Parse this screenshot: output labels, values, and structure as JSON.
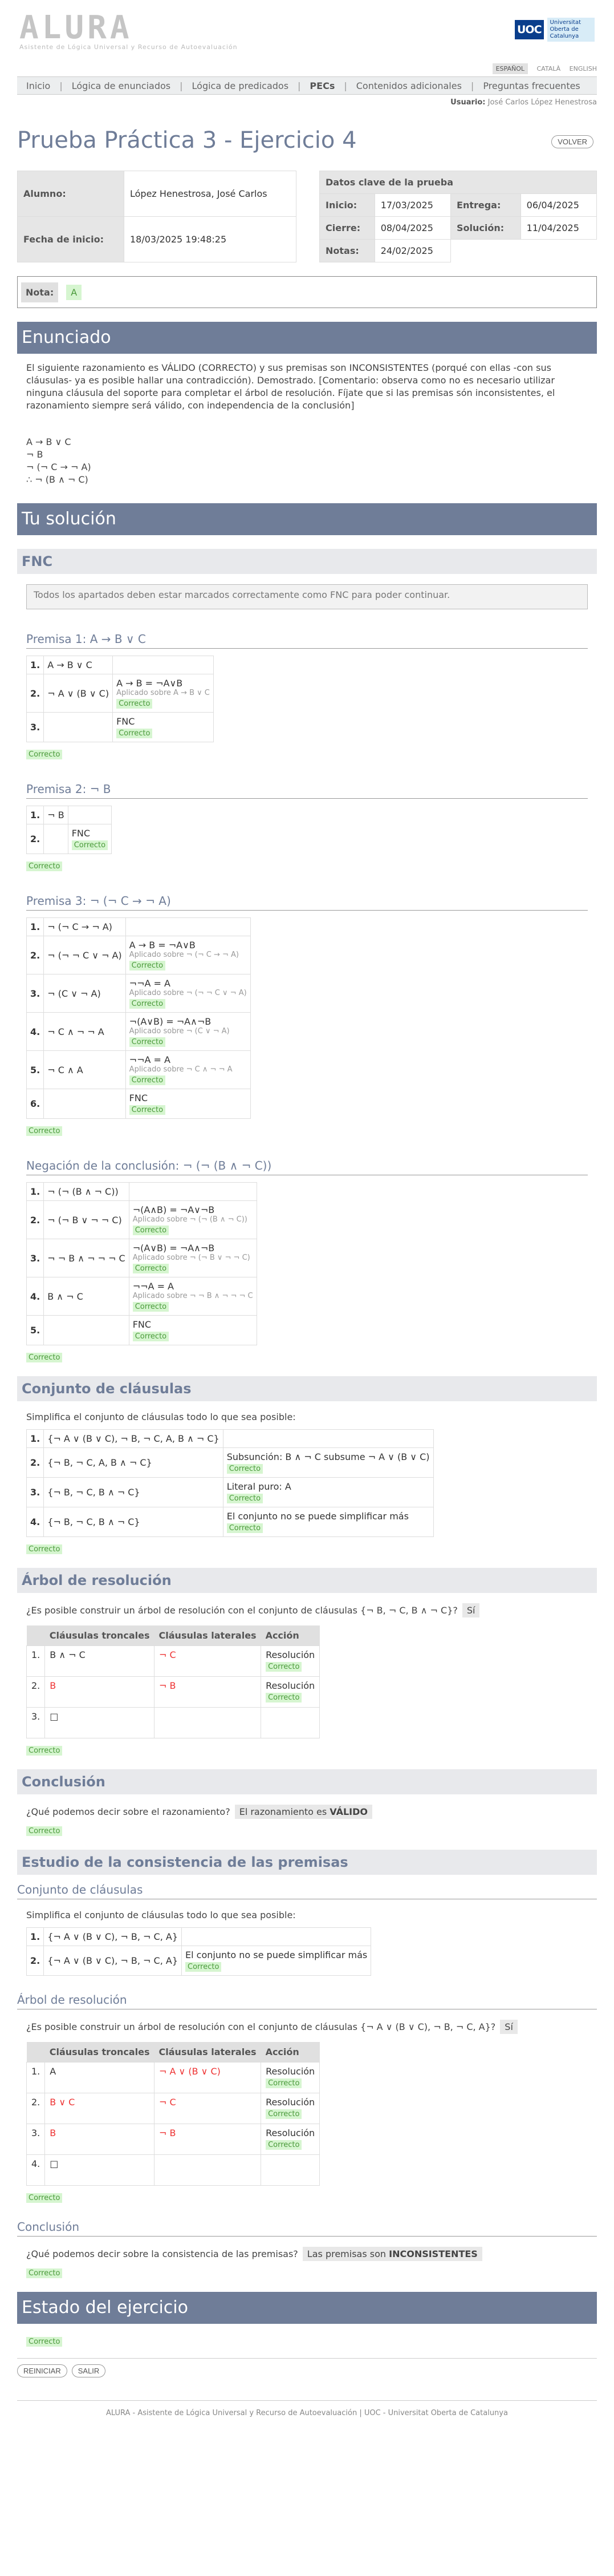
{
  "brand": {
    "logo": "ALURA",
    "tagline": "Asistente de Lógica Universal y Recurso de Autoevaluación",
    "uoc_mark": "UOC",
    "uoc_name": "Universitat Oberta de Catalunya"
  },
  "langs": [
    "Español",
    "Català",
    "English"
  ],
  "menu": [
    "Inicio",
    "Lógica de enunciados",
    "Lógica de predicados",
    "PECs",
    "Contenidos adicionales",
    "Preguntas frecuentes"
  ],
  "user": {
    "label": "Usuario:",
    "value": "José Carlos López Henestrosa"
  },
  "title": "Prueba Práctica 3 - Ejercicio 4",
  "back_btn": "Volver",
  "student": {
    "alumno_label": "Alumno:",
    "alumno": "López Henestrosa, José Carlos",
    "inicio_label": "Fecha de inicio:",
    "inicio": "18/03/2025 19:48:25"
  },
  "keydata": {
    "header": "Datos clave de la prueba",
    "inicio_label": "Inicio:",
    "inicio": "17/03/2025",
    "entrega_label": "Entrega:",
    "entrega": "06/04/2025",
    "cierre_label": "Cierre:",
    "cierre": "08/04/2025",
    "solucion_label": "Solución:",
    "solucion": "11/04/2025",
    "notas_label": "Notas:",
    "notas": "24/02/2025"
  },
  "nota": {
    "label": "Nota:",
    "value": "A"
  },
  "enunciado": {
    "head": "Enunciado",
    "text": "El siguiente razonamiento es VÁLIDO (CORRECTO) y sus premisas son INCONSISTENTES (porqué con ellas -con sus cláusulas- ya es posible hallar una contradicción). Demostrado. [Comentario: observa como no es necesario utilizar ninguna cláusula del soporte para completar el árbol de resolución. Fíjate que si las premisas són inconsistentes, el razonamiento siempre será válido, con independencia de la conclusión]",
    "premises": [
      "A → B ∨ C",
      "¬ B",
      "¬ (¬ C → ¬ A)",
      "∴ ¬ (B ∧ ¬ C)"
    ]
  },
  "solucion": {
    "head": "Tu solución"
  },
  "fnc": {
    "head": "FNC",
    "notice": "Todos los apartados deben estar marcados correctamente como FNC para poder continuar.",
    "correct": "Correcto",
    "p1": {
      "title": "Premisa 1: A → B ∨ C",
      "steps": [
        {
          "n": "1.",
          "f": "A → B ∨ C",
          "r": "",
          "a": ""
        },
        {
          "n": "2.",
          "f": "¬ A ∨ (B ∨ C)",
          "r": "A → B = ¬A∨B",
          "a": "Aplicado sobre A → B ∨ C"
        },
        {
          "n": "3.",
          "f": "",
          "r": "FNC",
          "a": ""
        }
      ]
    },
    "p2": {
      "title": "Premisa 2: ¬ B",
      "steps": [
        {
          "n": "1.",
          "f": "¬ B",
          "r": "",
          "a": ""
        },
        {
          "n": "2.",
          "f": "",
          "r": "FNC",
          "a": ""
        }
      ]
    },
    "p3": {
      "title": "Premisa 3: ¬ (¬ C → ¬ A)",
      "steps": [
        {
          "n": "1.",
          "f": "¬ (¬ C → ¬ A)",
          "r": "",
          "a": ""
        },
        {
          "n": "2.",
          "f": "¬ (¬ ¬ C ∨ ¬ A)",
          "r": "A → B = ¬A∨B",
          "a": "Aplicado sobre ¬ (¬ C → ¬ A)"
        },
        {
          "n": "3.",
          "f": "¬ (C ∨ ¬ A)",
          "r": "¬¬A = A",
          "a": "Aplicado sobre ¬ (¬ ¬ C ∨ ¬ A)"
        },
        {
          "n": "4.",
          "f": "¬ C ∧ ¬ ¬ A",
          "r": "¬(A∨B) = ¬A∧¬B",
          "a": "Aplicado sobre ¬ (C ∨ ¬ A)"
        },
        {
          "n": "5.",
          "f": "¬ C ∧ A",
          "r": "¬¬A = A",
          "a": "Aplicado sobre ¬ C ∧ ¬ ¬ A"
        },
        {
          "n": "6.",
          "f": "",
          "r": "FNC",
          "a": ""
        }
      ]
    },
    "neg": {
      "title": "Negación de la conclusión: ¬ (¬ (B ∧ ¬ C))",
      "steps": [
        {
          "n": "1.",
          "f": "¬ (¬ (B ∧ ¬ C))",
          "r": "",
          "a": ""
        },
        {
          "n": "2.",
          "f": "¬ (¬ B ∨ ¬ ¬ C)",
          "r": "¬(A∧B) = ¬A∨¬B",
          "a": "Aplicado sobre ¬ (¬ (B ∧ ¬ C))"
        },
        {
          "n": "3.",
          "f": "¬ ¬ B ∧ ¬ ¬ ¬ C",
          "r": "¬(A∨B) = ¬A∧¬B",
          "a": "Aplicado sobre ¬ (¬ B ∨ ¬ ¬ C)"
        },
        {
          "n": "4.",
          "f": "B ∧ ¬ C",
          "r": "¬¬A = A",
          "a": "Aplicado sobre ¬ ¬ B ∧ ¬ ¬ ¬ C"
        },
        {
          "n": "5.",
          "f": "",
          "r": "FNC",
          "a": ""
        }
      ]
    }
  },
  "clausulas": {
    "head": "Conjunto de cláusulas",
    "intro": "Simplifica el conjunto de cláusulas todo lo que sea posible:",
    "rows": [
      {
        "n": "1.",
        "f": "{¬ A ∨ (B ∨ C), ¬ B, ¬ C, A, B ∧ ¬ C}",
        "r": ""
      },
      {
        "n": "2.",
        "f": "{¬ B, ¬ C, A, B ∧ ¬ C}",
        "r": "Subsunción: B ∧ ¬ C subsume ¬ A ∨ (B ∨ C)"
      },
      {
        "n": "3.",
        "f": "{¬ B, ¬ C, B ∧ ¬ C}",
        "r": "Literal puro: A"
      },
      {
        "n": "4.",
        "f": "{¬ B, ¬ C, B ∧ ¬ C}",
        "r": "El conjunto no se puede simplificar más"
      }
    ]
  },
  "arbol": {
    "head": "Árbol de resolución",
    "question": "¿Es posible construir un árbol de resolución con el conjunto de cláusulas {¬ B, ¬ C, B ∧ ¬ C}?",
    "answer": "Sí",
    "cols": [
      "Cláusulas troncales",
      "Cláusulas laterales",
      "Acción"
    ],
    "rows": [
      {
        "n": "1.",
        "t": "B ∧ ¬ C",
        "l": "¬ C",
        "a": "Resolución"
      },
      {
        "n": "2.",
        "t": "B",
        "l": "¬ B",
        "a": "Resolución"
      },
      {
        "n": "3.",
        "t": "□",
        "l": "",
        "a": ""
      }
    ]
  },
  "conclusion": {
    "head": "Conclusión",
    "question": "¿Qué podemos decir sobre el razonamiento?",
    "answer_pre": "El razonamiento es",
    "answer_b": "VÁLIDO"
  },
  "consistencia": {
    "head": "Estudio de la consistencia de las premisas",
    "conj_title": "Conjunto de cláusulas",
    "intro": "Simplifica el conjunto de cláusulas todo lo que sea posible:",
    "rows": [
      {
        "n": "1.",
        "f": "{¬ A ∨ (B ∨ C), ¬ B, ¬ C, A}",
        "r": ""
      },
      {
        "n": "2.",
        "f": "{¬ A ∨ (B ∨ C), ¬ B, ¬ C, A}",
        "r": "El conjunto no se puede simplificar más"
      }
    ],
    "arbol_title": "Árbol de resolución",
    "question": "¿Es posible construir un árbol de resolución con el conjunto de cláusulas {¬ A ∨ (B ∨ C), ¬ B, ¬ C, A}?",
    "answer": "Sí",
    "tree": [
      {
        "n": "1.",
        "t": "A",
        "l": "¬ A ∨ (B ∨ C)",
        "a": "Resolución"
      },
      {
        "n": "2.",
        "t": "B ∨ C",
        "l": "¬ C",
        "a": "Resolución"
      },
      {
        "n": "3.",
        "t": "B",
        "l": "¬ B",
        "a": "Resolución"
      },
      {
        "n": "4.",
        "t": "□",
        "l": "",
        "a": ""
      }
    ],
    "concl_title": "Conclusión",
    "concl_q": "¿Qué podemos decir sobre la consistencia de las premisas?",
    "concl_pre": "Las premisas son",
    "concl_b": "INCONSISTENTES"
  },
  "estado": {
    "head": "Estado del ejercicio",
    "value": "Correcto"
  },
  "buttons": {
    "reiniciar": "Reiniciar",
    "salir": "Salir"
  },
  "footer": "ALURA - Asistente de Lógica Universal y Recurso de Autoevaluación | UOC - Universitat Oberta de Catalunya"
}
